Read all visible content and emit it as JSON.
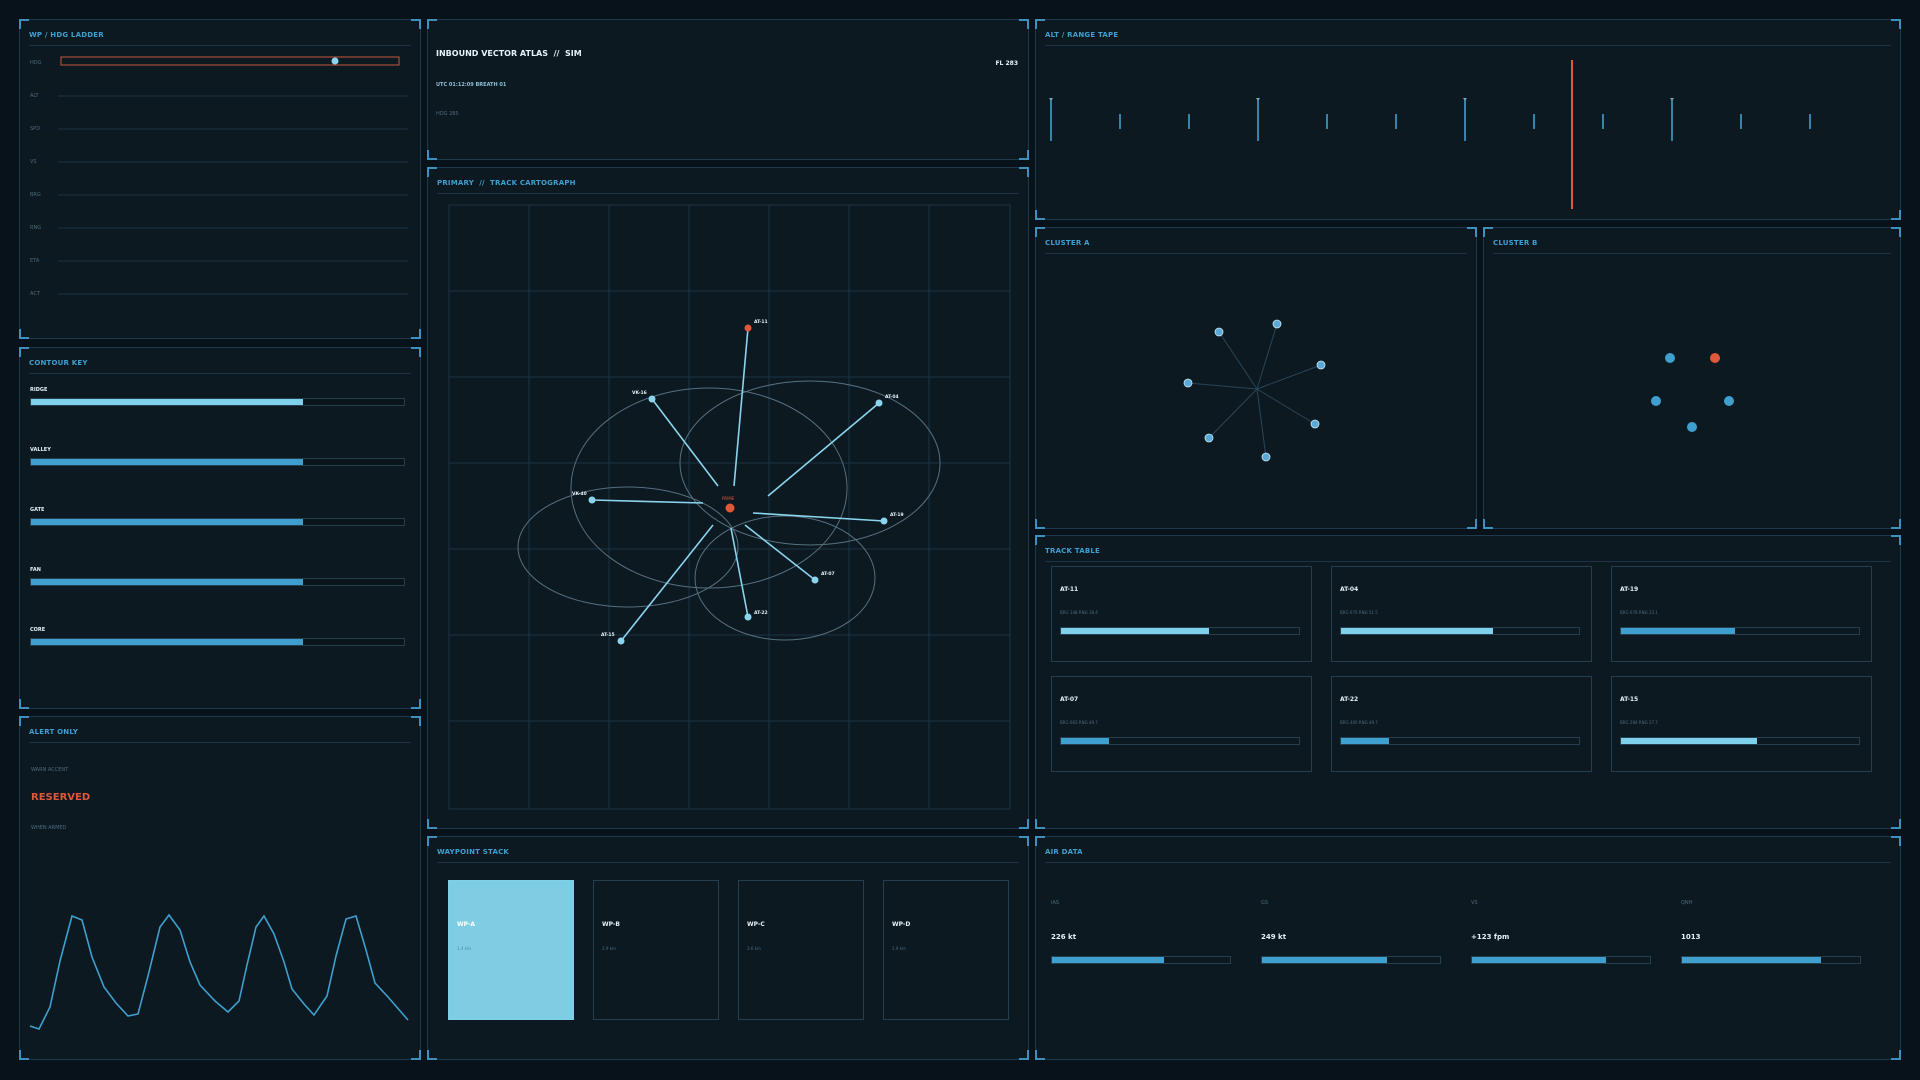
{
  "wp_ladder": {
    "title": "WP / HDG LADDER",
    "rows": [
      "HDG",
      "ALT",
      "SPD",
      "VS",
      "BRG",
      "RNG",
      "ETA",
      "ACT"
    ]
  },
  "contour_key": {
    "title": "CONTOUR KEY",
    "items": [
      {
        "label": "RIDGE",
        "value": 0.73,
        "color": "#7fd0ea"
      },
      {
        "label": "VALLEY",
        "value": 0.73,
        "color": "#3f9fcf"
      },
      {
        "label": "GATE",
        "value": 0.73,
        "color": "#3f9fcf"
      },
      {
        "label": "FAN",
        "value": 0.73,
        "color": "#3f9fcf"
      },
      {
        "label": "CORE",
        "value": 0.73,
        "color": "#3f9fcf"
      }
    ]
  },
  "alert": {
    "title": "ALERT ONLY",
    "caption": "WARN ACCENT",
    "status": "RESERVED",
    "sub": "WHEN ARMED"
  },
  "header": {
    "title": "INBOUND VECTOR ATLAS  //  SIM",
    "fl": "FL 283",
    "utc": "UTC 01:12:09  BREATH 01",
    "hdg": "HDG 285"
  },
  "map": {
    "title": "PRIMARY  //  TRACK CARTOGRAPH",
    "center_label": "PRIME",
    "tracks": [
      {
        "id": "AT-11",
        "color": "#e0573a"
      },
      {
        "id": "AT-04",
        "color": "#8ad4ee"
      },
      {
        "id": "AT-19",
        "color": "#8ad4ee"
      },
      {
        "id": "AT-07",
        "color": "#8ad4ee"
      },
      {
        "id": "AT-22",
        "color": "#8ad4ee"
      },
      {
        "id": "AT-15",
        "color": "#8ad4ee"
      },
      {
        "id": "VK-40",
        "color": "#8ad4ee"
      },
      {
        "id": "VK-16",
        "color": "#8ad4ee"
      }
    ]
  },
  "waypoints": {
    "title": "WAYPOINT STACK",
    "items": [
      {
        "name": "WP-A",
        "dist": "1.4 km",
        "active": true
      },
      {
        "name": "WP-B",
        "dist": "2.9 km",
        "active": false
      },
      {
        "name": "WP-C",
        "dist": "3.6 km",
        "active": false
      },
      {
        "name": "WP-D",
        "dist": "2.9 km",
        "active": false
      }
    ]
  },
  "alt_tape": {
    "title": "ALT / RANGE TAPE"
  },
  "cluster_a": {
    "title": "CLUSTER A"
  },
  "cluster_b": {
    "title": "CLUSTER B"
  },
  "track_table": {
    "title": "TRACK TABLE",
    "items": [
      {
        "id": "AT-11",
        "info": "BRG 148  RNG 38.4",
        "value": 0.62,
        "color": "#7fd0ea"
      },
      {
        "id": "AT-04",
        "info": "BRG 070  RNG 51.5",
        "value": 0.64,
        "color": "#7fd0ea"
      },
      {
        "id": "AT-19",
        "info": "BRG 078  RNG 23.1",
        "value": 0.48,
        "color": "#3f9fcf"
      },
      {
        "id": "AT-07",
        "info": "BRG 083  RNG 49.7",
        "value": 0.2,
        "color": "#3f9fcf"
      },
      {
        "id": "AT-22",
        "info": "BRG 400  RNG 49.7",
        "value": 0.2,
        "color": "#3f9fcf"
      },
      {
        "id": "AT-15",
        "info": "BRG 284  RNG 27.7",
        "value": 0.57,
        "color": "#7fd0ea"
      }
    ]
  },
  "air_data": {
    "title": "AIR DATA",
    "items": [
      {
        "label": "IAS",
        "value": "226 kt",
        "fill": 0.63
      },
      {
        "label": "GS",
        "value": "249 kt",
        "fill": 0.7
      },
      {
        "label": "VS",
        "value": "+123 fpm",
        "fill": 0.75
      },
      {
        "label": "QNH",
        "value": "1013",
        "fill": 0.78
      }
    ]
  },
  "colors": {
    "accent": "#3f9fcf",
    "light": "#8ad4ee",
    "warn": "#e0573a"
  }
}
